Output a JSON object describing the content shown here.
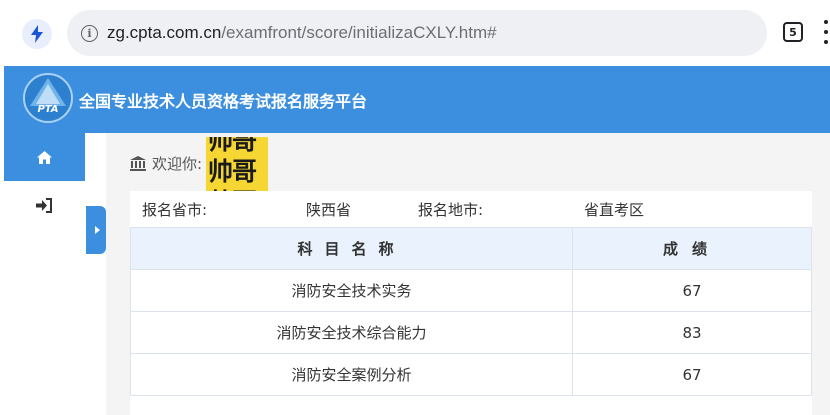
{
  "browser": {
    "url_host": "zg.cpta.com.cn",
    "url_path": "/examfront/score/initializaCXLY.htm#",
    "tab_count": "5"
  },
  "site": {
    "title": "全国专业技术人员资格考试报名服务平台",
    "logo_text": "PTA",
    "accent_color": "#3c8fde"
  },
  "sidebar": {
    "items": [
      {
        "icon": "home-icon",
        "active": true
      },
      {
        "icon": "sign-in-icon",
        "active": false
      }
    ]
  },
  "welcome": {
    "label": "欢迎你:",
    "name_sticker": "帅哥"
  },
  "info": {
    "province_label": "报名省市:",
    "province_value": "陕西省",
    "city_label": "报名地市:",
    "city_value": "省直考区"
  },
  "scores": {
    "headers": [
      "科目名称",
      "成绩"
    ],
    "rows": [
      {
        "subject": "消防安全技术实务",
        "score": "67"
      },
      {
        "subject": "消防安全技术综合能力",
        "score": "83"
      },
      {
        "subject": "消防安全案例分析",
        "score": "67"
      }
    ]
  }
}
